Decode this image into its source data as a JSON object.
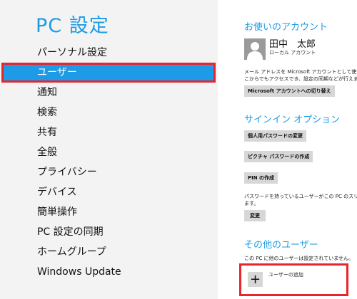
{
  "app": {
    "title": "PC 設定"
  },
  "nav": {
    "items": [
      "パーソナル設定",
      "ユーザー",
      "通知",
      "検索",
      "共有",
      "全般",
      "プライバシー",
      "デバイス",
      "簡単操作",
      "PC 設定の同期",
      "ホームグループ",
      "Windows Update"
    ],
    "selected_index": 1
  },
  "account": {
    "heading": "お使いのアカウント",
    "name": "田中　太郎",
    "type": "ローカル アカウント",
    "description_line1": "メール アドレスを Microsoft アカウントとして使って W",
    "description_line2": "こからでもアクセスでき、設定の同期などが行えます。",
    "switch_button": "Microsoft アカウントへの切り替え"
  },
  "signin": {
    "heading": "サインイン オプション",
    "change_password": "個人用パスワードの変更",
    "create_picture_password": "ピクチャ パスワードの作成",
    "create_pin": "PIN の作成",
    "note_line1": "パスワードを持っているユーザーがこの PC のスリープを",
    "note_line2": "ます。",
    "change_button": "変更"
  },
  "other_users": {
    "heading": "その他のユーザー",
    "none_text": "この PC に他のユーザーは設定されていません。",
    "add_label": "ユーザーの追加",
    "add_symbol": "+"
  },
  "colors": {
    "accent": "#1e9be6",
    "highlight_border": "#e8242c",
    "left_panel": "#f3f3f3",
    "button_bg": "#d7d7d7"
  }
}
